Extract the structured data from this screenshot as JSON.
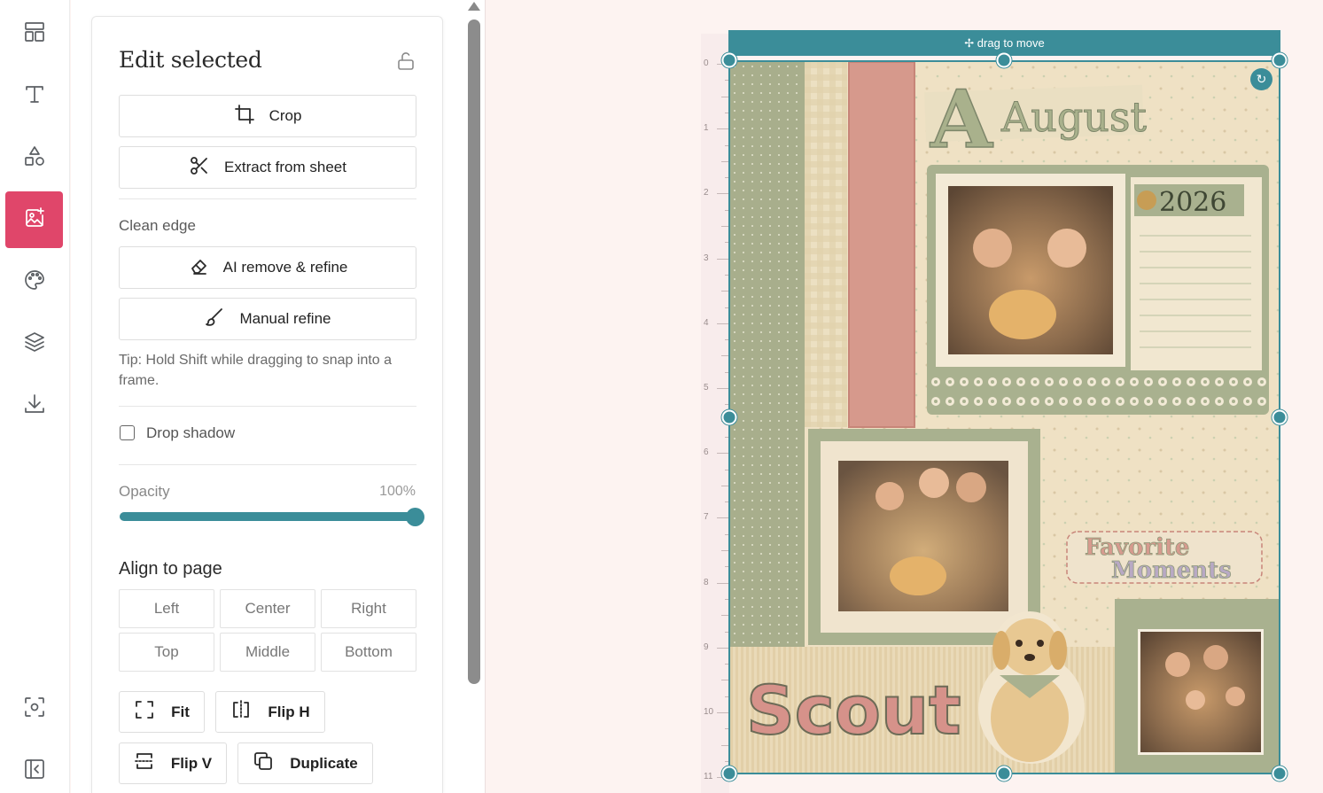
{
  "rail": {
    "items": [
      {
        "name": "layouts",
        "icon": "layout-icon",
        "active": false
      },
      {
        "name": "text",
        "icon": "text-icon",
        "active": false
      },
      {
        "name": "shapes",
        "icon": "shapes-icon",
        "active": false
      },
      {
        "name": "photos",
        "icon": "image-add-icon",
        "active": true
      },
      {
        "name": "colors",
        "icon": "palette-icon",
        "active": false
      },
      {
        "name": "layers",
        "icon": "layers-icon",
        "active": false
      },
      {
        "name": "export",
        "icon": "download-icon",
        "active": false
      }
    ],
    "bottom": [
      {
        "name": "focus",
        "icon": "focus-icon"
      },
      {
        "name": "collapse",
        "icon": "collapse-panel-icon"
      }
    ],
    "accent": "#e0466a"
  },
  "panel": {
    "title": "Edit selected",
    "crop_label": "Crop",
    "extract_label": "Extract from sheet",
    "clean_edge_label": "Clean edge",
    "ai_remove_label": "AI remove & refine",
    "manual_refine_label": "Manual refine",
    "tip": "Tip: Hold Shift while dragging to snap into a frame.",
    "drop_shadow_label": "Drop shadow",
    "drop_shadow_checked": false,
    "opacity_label": "Opacity",
    "opacity_value": "100%",
    "opacity_fraction": 1.0,
    "align_title": "Align to page",
    "align": {
      "left": "Left",
      "center": "Center",
      "right": "Right",
      "top": "Top",
      "middle": "Middle",
      "bottom": "Bottom"
    },
    "fit_label": "Fit",
    "flip_h_label": "Flip H",
    "flip_v_label": "Flip V",
    "duplicate_label": "Duplicate"
  },
  "canvas": {
    "drag_label": "✢ drag to move",
    "ruler_numbers": [
      "0",
      "1",
      "2",
      "3",
      "4",
      "5",
      "6",
      "7",
      "8",
      "9",
      "10",
      "11"
    ],
    "accent": "#3b8d99",
    "page": {
      "title_text": "August",
      "year_text": "2026",
      "favorite_line1": "Favorite",
      "favorite_line2": "Moments",
      "name_text": "Scout"
    }
  }
}
